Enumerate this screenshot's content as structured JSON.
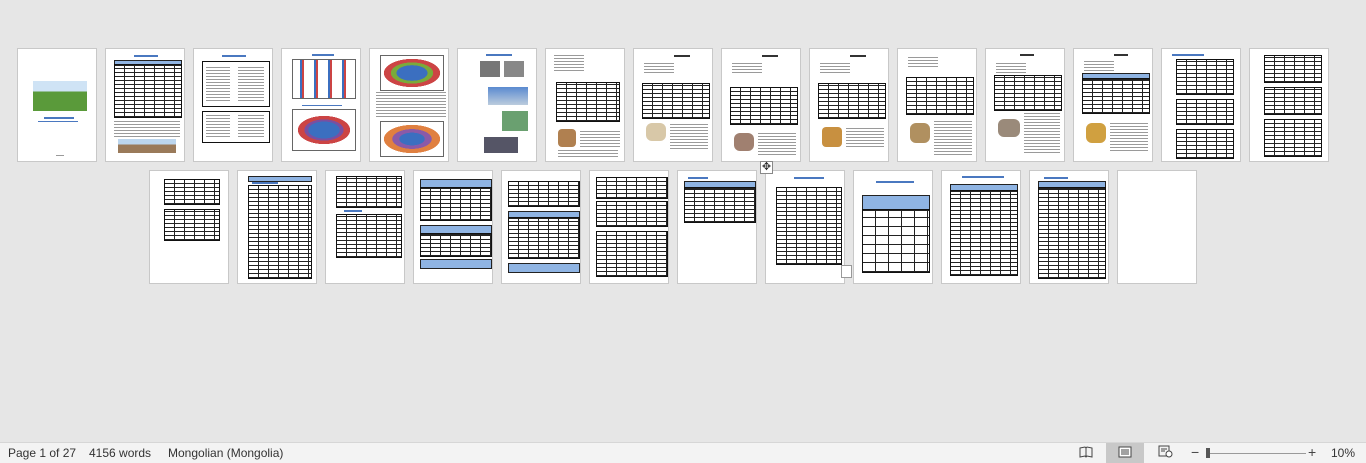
{
  "status_bar": {
    "page_info": "Page 1 of 27",
    "word_count": "4156 words",
    "language": "Mongolian (Mongolia)",
    "zoom_level": "10%",
    "zoom_minus": "−",
    "zoom_plus": "+"
  },
  "view_buttons": [
    {
      "name": "read-mode",
      "icon": "book-icon",
      "glyph": "📖"
    },
    {
      "name": "print-layout",
      "icon": "page-layout-icon",
      "glyph": "▤"
    },
    {
      "name": "web-layout",
      "icon": "web-layout-icon",
      "glyph": "🌐"
    }
  ],
  "page_count_visible": 27,
  "zoom_percent": 10,
  "colors": {
    "background": "#e6e6e6",
    "status_bar": "#f3f3f3",
    "table_header": "#8fb4e3",
    "title_blue": "#4a78c0"
  }
}
